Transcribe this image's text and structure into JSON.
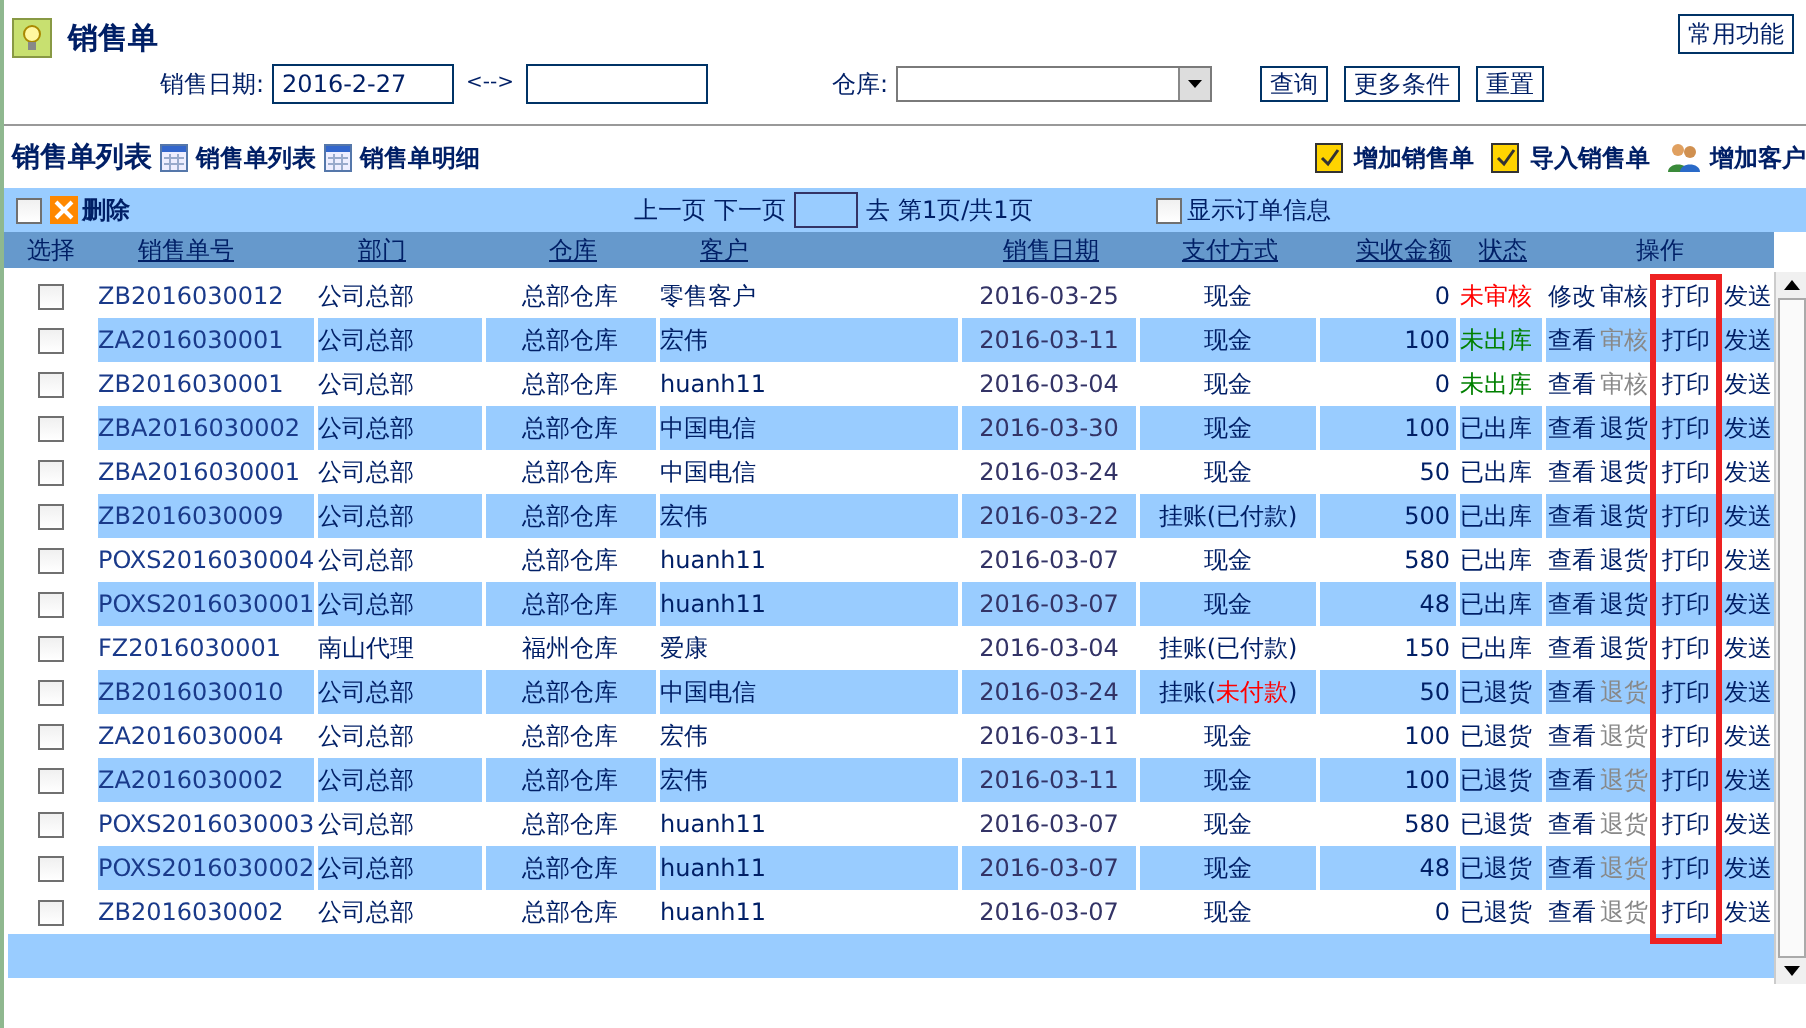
{
  "page": {
    "title": "销售单",
    "menu_button": "常用功能"
  },
  "filters": {
    "date_label": "销售日期:",
    "date_from": "2016-2-27",
    "range_sep": "<-->",
    "warehouse_label": "仓库:",
    "buttons": [
      "查询",
      "更多条件",
      "重置"
    ]
  },
  "list_header": {
    "title": "销售单列表",
    "views": [
      "销售单列表",
      "销售单明细"
    ],
    "actions": [
      "增加销售单",
      "导入销售单",
      "增加客户"
    ]
  },
  "toolbar": {
    "select_all_checked": false,
    "delete": "删除",
    "prev": "上一页",
    "next": "下一页",
    "goto": "去",
    "page_info": "第1页/共1页",
    "show_info_label": "显示订单信息",
    "show_info_checked": false
  },
  "table": {
    "columns": [
      "选择",
      "销售单号",
      "部门",
      "仓库",
      "客户",
      "销售日期",
      "支付方式",
      "实收金额",
      "状态",
      "操作"
    ],
    "rows": [
      {
        "checked": false,
        "no": "ZB2016030012",
        "dept": "公司总部",
        "wh": "总部仓库",
        "customer": "零售客户",
        "date": "2016-03-25",
        "pay": {
          "prefix": "现金"
        },
        "amount": "0",
        "status": "未审核",
        "color": "#ff0000",
        "ops": [
          {
            "label": "修改",
            "enabled": true
          },
          {
            "label": "审核",
            "enabled": true
          },
          {
            "label": "打印",
            "enabled": true
          },
          {
            "label": "发送",
            "enabled": true
          }
        ]
      },
      {
        "checked": false,
        "no": "ZA2016030001",
        "dept": "公司总部",
        "wh": "总部仓库",
        "customer": "宏伟",
        "date": "2016-03-11",
        "pay": {
          "prefix": "现金"
        },
        "amount": "100",
        "status": "未出库",
        "color": "#008000",
        "ops": [
          {
            "label": "查看",
            "enabled": true
          },
          {
            "label": "审核",
            "enabled": false
          },
          {
            "label": "打印",
            "enabled": true
          },
          {
            "label": "发送",
            "enabled": true
          }
        ]
      },
      {
        "checked": false,
        "no": "ZB2016030001",
        "dept": "公司总部",
        "wh": "总部仓库",
        "customer": "huanh11",
        "date": "2016-03-04",
        "pay": {
          "prefix": "现金"
        },
        "amount": "0",
        "status": "未出库",
        "color": "#008000",
        "ops": [
          {
            "label": "查看",
            "enabled": true
          },
          {
            "label": "审核",
            "enabled": false
          },
          {
            "label": "打印",
            "enabled": true
          },
          {
            "label": "发送",
            "enabled": true
          }
        ]
      },
      {
        "checked": false,
        "no": "ZBA2016030002",
        "dept": "公司总部",
        "wh": "总部仓库",
        "customer": "中国电信",
        "date": "2016-03-30",
        "pay": {
          "prefix": "现金"
        },
        "amount": "100",
        "status": "已出库",
        "color": "#001f66",
        "ops": [
          {
            "label": "查看",
            "enabled": true
          },
          {
            "label": "退货",
            "enabled": true
          },
          {
            "label": "打印",
            "enabled": true
          },
          {
            "label": "发送",
            "enabled": true
          }
        ]
      },
      {
        "checked": false,
        "no": "ZBA2016030001",
        "dept": "公司总部",
        "wh": "总部仓库",
        "customer": "中国电信",
        "date": "2016-03-24",
        "pay": {
          "prefix": "现金"
        },
        "amount": "50",
        "status": "已出库",
        "color": "#001f66",
        "ops": [
          {
            "label": "查看",
            "enabled": true
          },
          {
            "label": "退货",
            "enabled": true
          },
          {
            "label": "打印",
            "enabled": true
          },
          {
            "label": "发送",
            "enabled": true
          }
        ]
      },
      {
        "checked": false,
        "no": "ZB2016030009",
        "dept": "公司总部",
        "wh": "总部仓库",
        "customer": "宏伟",
        "date": "2016-03-22",
        "pay": {
          "prefix": "挂账(",
          "note": "已付款",
          "suffix": ")",
          "overdue": false
        },
        "amount": "500",
        "status": "已出库",
        "color": "#001f66",
        "ops": [
          {
            "label": "查看",
            "enabled": true
          },
          {
            "label": "退货",
            "enabled": true
          },
          {
            "label": "打印",
            "enabled": true
          },
          {
            "label": "发送",
            "enabled": true
          }
        ]
      },
      {
        "checked": false,
        "no": "POXS2016030004",
        "dept": "公司总部",
        "wh": "总部仓库",
        "customer": "huanh11",
        "date": "2016-03-07",
        "pay": {
          "prefix": "现金"
        },
        "amount": "580",
        "status": "已出库",
        "color": "#001f66",
        "ops": [
          {
            "label": "查看",
            "enabled": true
          },
          {
            "label": "退货",
            "enabled": true
          },
          {
            "label": "打印",
            "enabled": true
          },
          {
            "label": "发送",
            "enabled": true
          }
        ]
      },
      {
        "checked": false,
        "no": "POXS2016030001",
        "dept": "公司总部",
        "wh": "总部仓库",
        "customer": "huanh11",
        "date": "2016-03-07",
        "pay": {
          "prefix": "现金"
        },
        "amount": "48",
        "status": "已出库",
        "color": "#001f66",
        "ops": [
          {
            "label": "查看",
            "enabled": true
          },
          {
            "label": "退货",
            "enabled": true
          },
          {
            "label": "打印",
            "enabled": true
          },
          {
            "label": "发送",
            "enabled": true
          }
        ]
      },
      {
        "checked": false,
        "no": "FZ2016030001",
        "dept": "南山代理",
        "wh": "福州仓库",
        "customer": "爱康",
        "date": "2016-03-04",
        "pay": {
          "prefix": "挂账(",
          "note": "已付款",
          "suffix": ")",
          "overdue": false
        },
        "amount": "150",
        "status": "已出库",
        "color": "#001f66",
        "ops": [
          {
            "label": "查看",
            "enabled": true
          },
          {
            "label": "退货",
            "enabled": true
          },
          {
            "label": "打印",
            "enabled": true
          },
          {
            "label": "发送",
            "enabled": true
          }
        ]
      },
      {
        "checked": false,
        "no": "ZB2016030010",
        "dept": "公司总部",
        "wh": "总部仓库",
        "customer": "中国电信",
        "date": "2016-03-24",
        "pay": {
          "prefix": "挂账(",
          "note": "未付款",
          "suffix": ")",
          "overdue": true
        },
        "amount": "50",
        "status": "已退货",
        "color": "#001f66",
        "ops": [
          {
            "label": "查看",
            "enabled": true
          },
          {
            "label": "退货",
            "enabled": false
          },
          {
            "label": "打印",
            "enabled": true
          },
          {
            "label": "发送",
            "enabled": true
          }
        ]
      },
      {
        "checked": false,
        "no": "ZA2016030004",
        "dept": "公司总部",
        "wh": "总部仓库",
        "customer": "宏伟",
        "date": "2016-03-11",
        "pay": {
          "prefix": "现金"
        },
        "amount": "100",
        "status": "已退货",
        "color": "#001f66",
        "ops": [
          {
            "label": "查看",
            "enabled": true
          },
          {
            "label": "退货",
            "enabled": false
          },
          {
            "label": "打印",
            "enabled": true
          },
          {
            "label": "发送",
            "enabled": true
          }
        ]
      },
      {
        "checked": false,
        "no": "ZA2016030002",
        "dept": "公司总部",
        "wh": "总部仓库",
        "customer": "宏伟",
        "date": "2016-03-11",
        "pay": {
          "prefix": "现金"
        },
        "amount": "100",
        "status": "已退货",
        "color": "#001f66",
        "ops": [
          {
            "label": "查看",
            "enabled": true
          },
          {
            "label": "退货",
            "enabled": false
          },
          {
            "label": "打印",
            "enabled": true
          },
          {
            "label": "发送",
            "enabled": true
          }
        ]
      },
      {
        "checked": false,
        "no": "POXS2016030003",
        "dept": "公司总部",
        "wh": "总部仓库",
        "customer": "huanh11",
        "date": "2016-03-07",
        "pay": {
          "prefix": "现金"
        },
        "amount": "580",
        "status": "已退货",
        "color": "#001f66",
        "ops": [
          {
            "label": "查看",
            "enabled": true
          },
          {
            "label": "退货",
            "enabled": false
          },
          {
            "label": "打印",
            "enabled": true
          },
          {
            "label": "发送",
            "enabled": true
          }
        ]
      },
      {
        "checked": false,
        "no": "POXS2016030002",
        "dept": "公司总部",
        "wh": "总部仓库",
        "customer": "huanh11",
        "date": "2016-03-07",
        "pay": {
          "prefix": "现金"
        },
        "amount": "48",
        "status": "已退货",
        "color": "#001f66",
        "ops": [
          {
            "label": "查看",
            "enabled": true
          },
          {
            "label": "退货",
            "enabled": false
          },
          {
            "label": "打印",
            "enabled": true
          },
          {
            "label": "发送",
            "enabled": true
          }
        ]
      },
      {
        "checked": false,
        "no": "ZB2016030002",
        "dept": "公司总部",
        "wh": "总部仓库",
        "customer": "huanh11",
        "date": "2016-03-07",
        "pay": {
          "prefix": "现金"
        },
        "amount": "0",
        "status": "已退货",
        "color": "#001f66",
        "ops": [
          {
            "label": "查看",
            "enabled": true
          },
          {
            "label": "退货",
            "enabled": false
          },
          {
            "label": "打印",
            "enabled": true
          },
          {
            "label": "发送",
            "enabled": true
          }
        ]
      }
    ]
  }
}
